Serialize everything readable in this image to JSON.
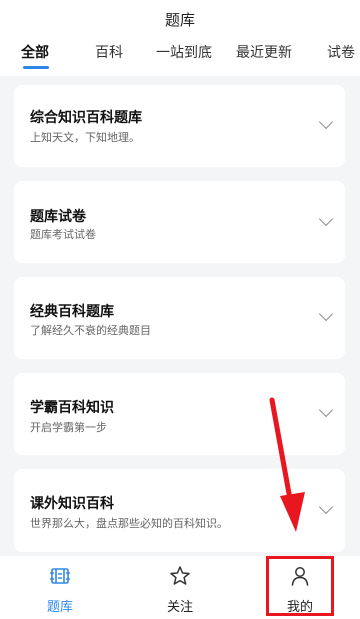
{
  "header": {
    "title": "题库"
  },
  "tabs": [
    {
      "label": "全部",
      "active": true
    },
    {
      "label": "百科"
    },
    {
      "label": "一站到底"
    },
    {
      "label": "最近更新"
    },
    {
      "label": "试卷"
    }
  ],
  "cards": [
    {
      "title": "综合知识百科题库",
      "subtitle": "上知天文，下知地理。"
    },
    {
      "title": "题库试卷",
      "subtitle": "题库考试试卷"
    },
    {
      "title": "经典百科题库",
      "subtitle": "了解经久不衰的经典题目"
    },
    {
      "title": "学霸百科知识",
      "subtitle": "开启学霸第一步"
    },
    {
      "title": "课外知识百科",
      "subtitle": "世界那么大，盘点那些必知的百科知识。"
    }
  ],
  "tabbar": {
    "items": [
      {
        "label": "题库",
        "icon": "question-bank-icon",
        "active": true
      },
      {
        "label": "关注",
        "icon": "star-icon"
      },
      {
        "label": "我的",
        "icon": "person-icon"
      }
    ]
  },
  "colors": {
    "accent": "#2f88e8",
    "annotation": "#e8161f",
    "background": "#f4f5f7"
  }
}
